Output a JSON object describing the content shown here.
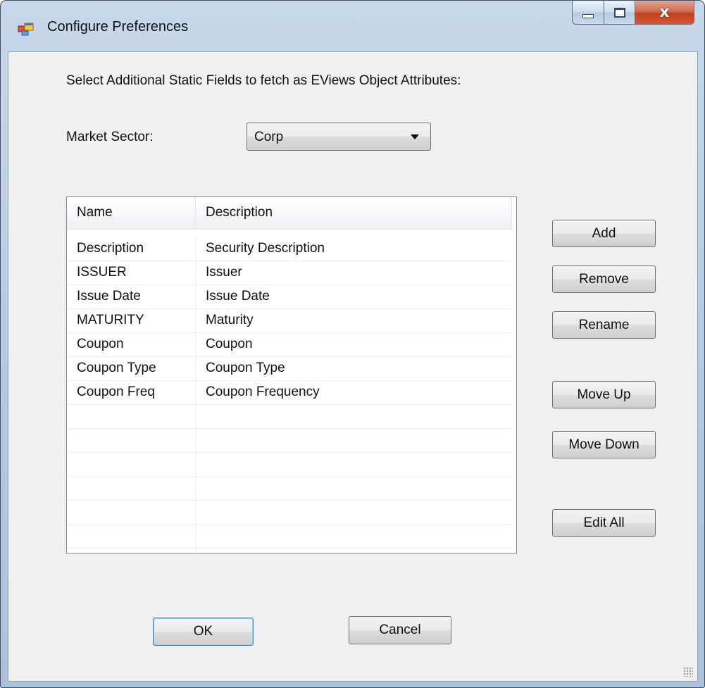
{
  "window": {
    "title": "Configure Preferences",
    "close_glyph": "x"
  },
  "instructions": "Select Additional Static Fields to fetch as EViews Object Attributes:",
  "market_sector": {
    "label": "Market Sector:",
    "value": "Corp"
  },
  "list": {
    "columns": [
      "Name",
      "Description"
    ],
    "rows": [
      {
        "name": "Description",
        "description": "Security Description"
      },
      {
        "name": "ISSUER",
        "description": "Issuer"
      },
      {
        "name": "Issue Date",
        "description": "Issue Date"
      },
      {
        "name": "MATURITY",
        "description": "Maturity"
      },
      {
        "name": "Coupon",
        "description": "Coupon"
      },
      {
        "name": "Coupon Type",
        "description": "Coupon Type"
      },
      {
        "name": "Coupon Freq",
        "description": "Coupon Frequency"
      },
      {
        "name": "",
        "description": ""
      },
      {
        "name": "",
        "description": ""
      },
      {
        "name": "",
        "description": ""
      },
      {
        "name": "",
        "description": ""
      },
      {
        "name": "",
        "description": ""
      },
      {
        "name": "",
        "description": ""
      },
      {
        "name": "",
        "description": ""
      }
    ]
  },
  "buttons": {
    "add": "Add",
    "remove": "Remove",
    "rename": "Rename",
    "move_up": "Move Up",
    "move_down": "Move Down",
    "edit_all": "Edit All",
    "ok": "OK",
    "cancel": "Cancel"
  },
  "icons": {
    "app": "app-window-icon",
    "minimize": "minimize-icon",
    "maximize": "maximize-icon",
    "close": "close-icon",
    "dropdown": "chevron-down-icon",
    "resize": "resize-grip-icon"
  }
}
